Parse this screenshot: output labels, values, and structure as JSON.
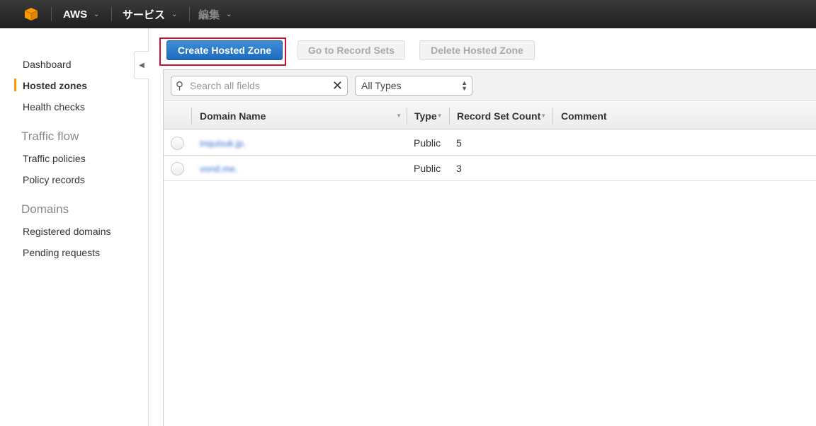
{
  "topbar": {
    "logo_icon": "aws-cube-icon",
    "logo_color": "#f90",
    "items": [
      {
        "label": "AWS"
      },
      {
        "label": "サービス"
      },
      {
        "label": "編集"
      }
    ]
  },
  "sidebar": {
    "items": [
      {
        "label": "Dashboard"
      },
      {
        "label": "Hosted zones",
        "active": true
      },
      {
        "label": "Health checks"
      }
    ],
    "sections": [
      {
        "heading": "Traffic flow",
        "items": [
          {
            "label": "Traffic policies"
          },
          {
            "label": "Policy records"
          }
        ]
      },
      {
        "heading": "Domains",
        "items": [
          {
            "label": "Registered domains"
          },
          {
            "label": "Pending requests"
          }
        ]
      }
    ]
  },
  "toolbar": {
    "create": "Create Hosted Zone",
    "goto": "Go to Record Sets",
    "delete": "Delete Hosted Zone"
  },
  "filter": {
    "search_placeholder": "Search all fields",
    "type_select": "All Types"
  },
  "table": {
    "columns": [
      "Domain Name",
      "Type",
      "Record Set Count",
      "Comment"
    ],
    "rows": [
      {
        "domain": "inquisuk.jp.",
        "type": "Public",
        "count": "5",
        "comment": ""
      },
      {
        "domain": "vond.me.",
        "type": "Public",
        "count": "3",
        "comment": ""
      }
    ]
  }
}
